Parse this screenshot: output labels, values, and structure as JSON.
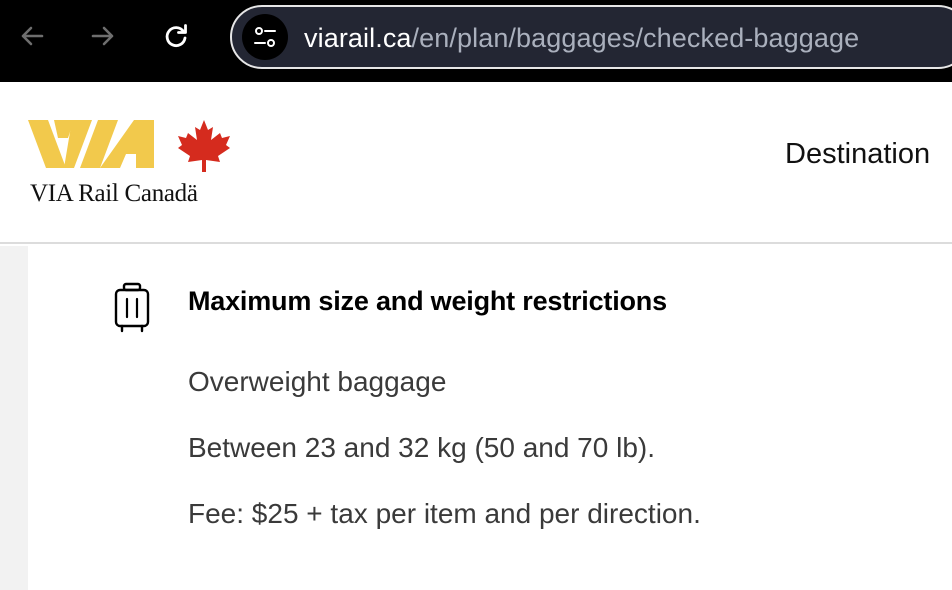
{
  "browser": {
    "url_host": "viarail.ca",
    "url_path": "/en/plan/baggages/checked-baggage",
    "icons": [
      "back-arrow-icon",
      "forward-arrow-icon",
      "reload-icon",
      "site-settings-icon"
    ]
  },
  "header": {
    "logo_mark": "VIA",
    "logo_text": "VIA Rail Canadä",
    "nav_item": "Destination"
  },
  "section": {
    "icon": "suitcase-icon",
    "title": "Maximum size and weight restrictions",
    "subtitle": "Overweight baggage",
    "weight_range": "Between 23 and 32 kg (50 and 70 lb).",
    "fee": "Fee: $25 + tax per item and per direction."
  },
  "colors": {
    "brand_yellow": "#F2C94C",
    "maple_red": "#D52B1E",
    "chrome_bg": "#000000",
    "urlbar_bg": "#232633"
  }
}
